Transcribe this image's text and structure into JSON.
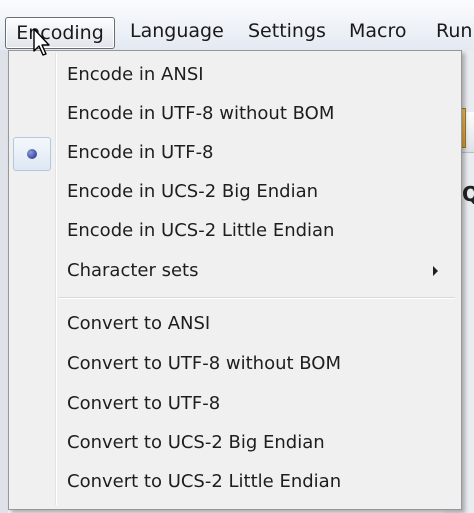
{
  "menubar": {
    "items": [
      {
        "label": "Encoding"
      },
      {
        "label": "Language"
      },
      {
        "label": "Settings"
      },
      {
        "label": "Macro"
      },
      {
        "label": "Run"
      }
    ]
  },
  "background": {
    "partial_text": "Q"
  },
  "encoding_menu": {
    "items": [
      {
        "label": "Encode in ANSI",
        "checked": false
      },
      {
        "label": "Encode in UTF-8 without BOM",
        "checked": false
      },
      {
        "label": "Encode in UTF-8",
        "checked": true
      },
      {
        "label": "Encode in UCS-2 Big Endian",
        "checked": false
      },
      {
        "label": "Encode in UCS-2 Little Endian",
        "checked": false
      },
      {
        "label": "Character sets",
        "has_submenu": true
      },
      {
        "label": "Convert to ANSI"
      },
      {
        "label": "Convert to UTF-8 without BOM"
      },
      {
        "label": "Convert to UTF-8"
      },
      {
        "label": "Convert to UCS-2 Big Endian"
      },
      {
        "label": "Convert to UCS-2 Little Endian"
      }
    ]
  },
  "icons": {
    "radio": "radio-selected-icon",
    "submenu": "submenu-arrow-icon",
    "cursor": "mouse-pointer-icon"
  }
}
